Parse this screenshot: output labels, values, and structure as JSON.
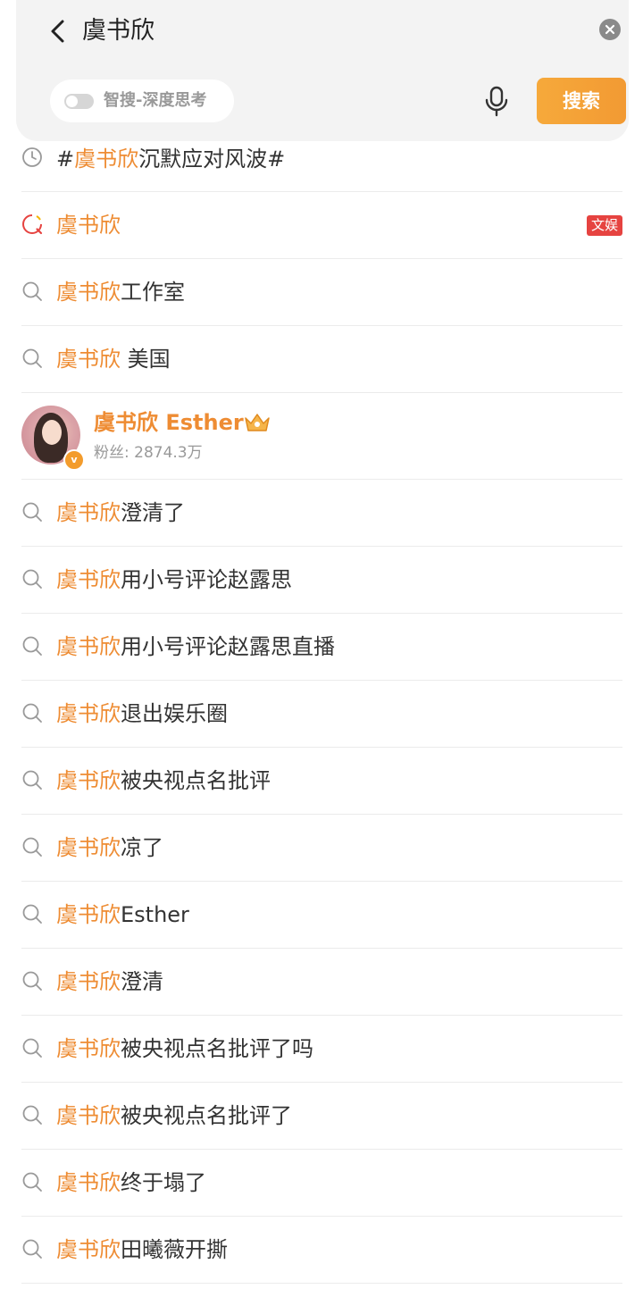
{
  "header": {
    "query": "虞书欣",
    "ai_toggle_label": "智搜-深度思考",
    "ai_toggle_on": false,
    "search_button_label": "搜索"
  },
  "highlight_term": "虞书欣",
  "colors": {
    "highlight": "#ee8c33",
    "search_button": "#f29a33",
    "badge_red": "#e64340"
  },
  "suggestions_top": [
    {
      "icon": "history-clock-icon",
      "prefix": "#",
      "highlight": "虞书欣",
      "suffix": "沉默应对风波#"
    },
    {
      "icon": "hot-search-icon",
      "prefix": "",
      "highlight": "虞书欣",
      "suffix": "",
      "badge": "文娱"
    },
    {
      "icon": "search-icon",
      "prefix": "",
      "highlight": "虞书欣",
      "suffix": "工作室"
    },
    {
      "icon": "search-icon",
      "prefix": "",
      "highlight": "虞书欣",
      "suffix": " 美国"
    }
  ],
  "user_result": {
    "name": "虞书欣 Esther",
    "fans_label": "粉丝: 2874.3万",
    "verified_mark": "v",
    "badge_icon": "crown-icon"
  },
  "suggestions_bottom": [
    {
      "highlight": "虞书欣",
      "suffix": "澄清了"
    },
    {
      "highlight": "虞书欣",
      "suffix": "用小号评论赵露思"
    },
    {
      "highlight": "虞书欣",
      "suffix": "用小号评论赵露思直播"
    },
    {
      "highlight": "虞书欣",
      "suffix": "退出娱乐圈"
    },
    {
      "highlight": "虞书欣",
      "suffix": "被央视点名批评"
    },
    {
      "highlight": "虞书欣",
      "suffix": "凉了"
    },
    {
      "highlight": "虞书欣",
      "suffix": "Esther"
    },
    {
      "highlight": "虞书欣",
      "suffix": "澄清"
    },
    {
      "highlight": "虞书欣",
      "suffix": "被央视点名批评了吗"
    },
    {
      "highlight": "虞书欣",
      "suffix": "被央视点名批评了"
    },
    {
      "highlight": "虞书欣",
      "suffix": "终于塌了"
    },
    {
      "highlight": "虞书欣",
      "suffix": "田曦薇开撕"
    }
  ]
}
